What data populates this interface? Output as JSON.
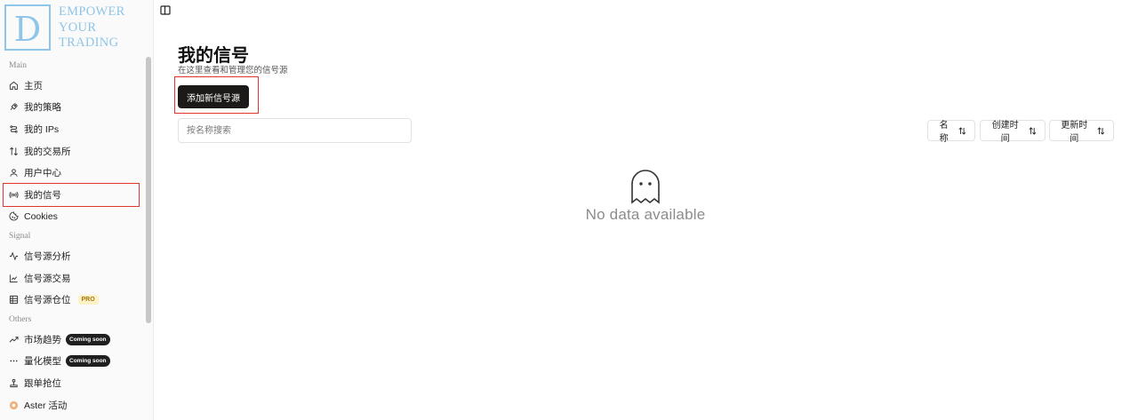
{
  "brand": {
    "letter": "D",
    "lines": [
      "EMPOWER",
      "YOUR",
      "TRADING"
    ]
  },
  "sidebar": {
    "sections": [
      {
        "label": "Main",
        "items": [
          {
            "label": "主页",
            "icon": "home-icon"
          },
          {
            "label": "我的策略",
            "icon": "rocket-icon"
          },
          {
            "label": "我的 IPs",
            "icon": "route-icon"
          },
          {
            "label": "我的交易所",
            "icon": "exchange-icon"
          },
          {
            "label": "用户中心",
            "icon": "user-icon"
          },
          {
            "label": "我的信号",
            "icon": "radio-icon",
            "active": true
          },
          {
            "label": "Cookies",
            "icon": "cookie-icon"
          }
        ]
      },
      {
        "label": "Signal",
        "items": [
          {
            "label": "信号源分析",
            "icon": "activity-icon"
          },
          {
            "label": "信号源交易",
            "icon": "line-chart-icon"
          },
          {
            "label": "信号源仓位",
            "icon": "table-icon",
            "badge": "PRO"
          }
        ]
      },
      {
        "label": "Others",
        "items": [
          {
            "label": "市场趋势",
            "icon": "trend-icon",
            "badge": "Coming soon"
          },
          {
            "label": "量化模型",
            "icon": "ellipsis-icon",
            "badge": "Coming soon"
          },
          {
            "label": "跟单抢位",
            "icon": "joystick-icon"
          },
          {
            "label": "Aster 活动",
            "icon": "aster-icon"
          }
        ]
      }
    ]
  },
  "page": {
    "title": "我的信号",
    "subtitle": "在这里查看和管理您的信号源",
    "add_button": "添加新信号源",
    "search_placeholder": "按名称搜索",
    "sort_buttons": [
      "名称",
      "创建时间",
      "更新时间"
    ],
    "empty_text": "No data available"
  },
  "colors": {
    "accent_red": "#e0342c",
    "brand_blue": "#8ec5e8",
    "button_dark": "#1c1a19"
  }
}
